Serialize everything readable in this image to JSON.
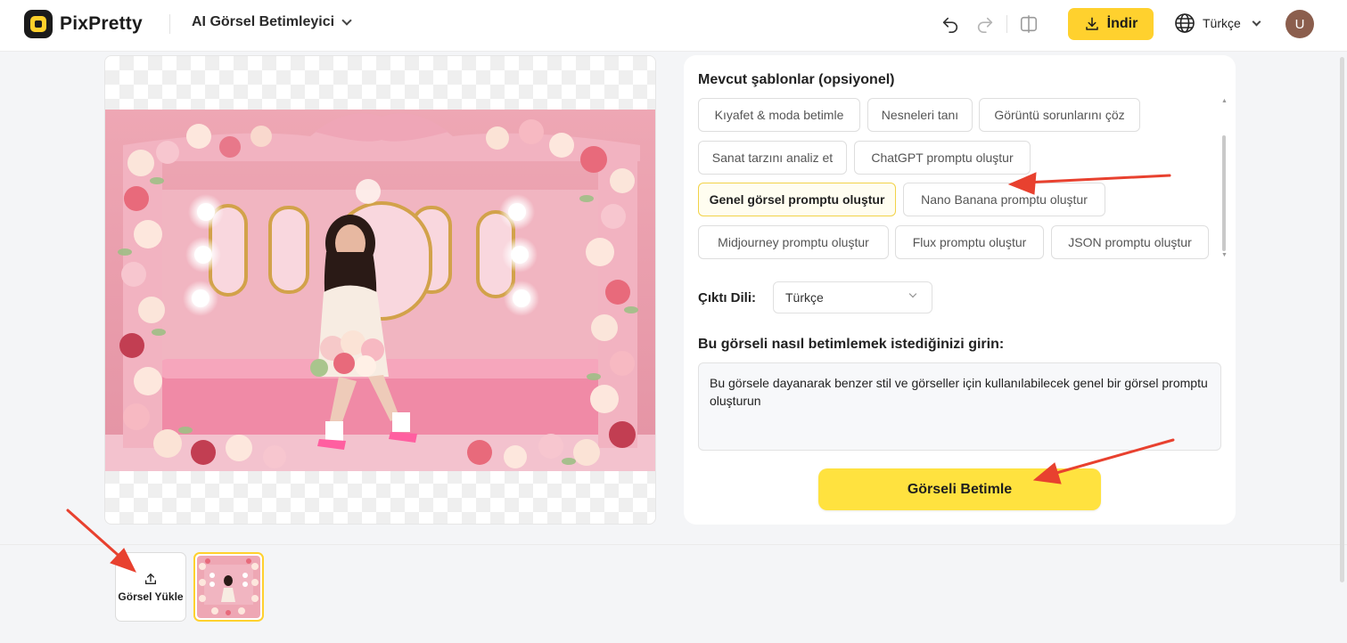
{
  "header": {
    "brand": "PixPretty",
    "tool_name": "AI Görsel Betimleyici",
    "download_label": "İndir",
    "language": "Türkçe",
    "avatar_initial": "U"
  },
  "templates": {
    "title": "Mevcut şablonlar (opsiyonel)",
    "items": [
      "Kıyafet & moda betimle",
      "Nesneleri tanı",
      "Görüntü sorunlarını çöz",
      "Sanat tarzını analiz et",
      "ChatGPT promptu oluştur",
      "Genel görsel promptu oluştur",
      "Nano Banana promptu oluştur",
      "Midjourney promptu oluştur",
      "Flux promptu oluştur",
      "JSON promptu oluştur"
    ],
    "selected": "Genel görsel promptu oluştur"
  },
  "output_language": {
    "label": "Çıktı Dili:",
    "value": "Türkçe"
  },
  "prompt": {
    "label": "Bu görseli nasıl betimlemek istediğinizi girin:",
    "value": "Bu görsele dayanarak benzer stil ve görseller için kullanılabilecek genel bir görsel promptu oluşturun"
  },
  "describe_button": "Görseli Betimle",
  "upload_label": "Görsel Yükle",
  "icons": [
    "undo-icon",
    "redo-icon",
    "compare-icon",
    "download-icon",
    "globe-icon",
    "chevron-down-icon",
    "upload-icon"
  ],
  "colors": {
    "accent": "#ffd12e",
    "button": "#ffe23f",
    "selected_chip_border": "#f2d248",
    "annotation_arrow": "#e8412f"
  }
}
